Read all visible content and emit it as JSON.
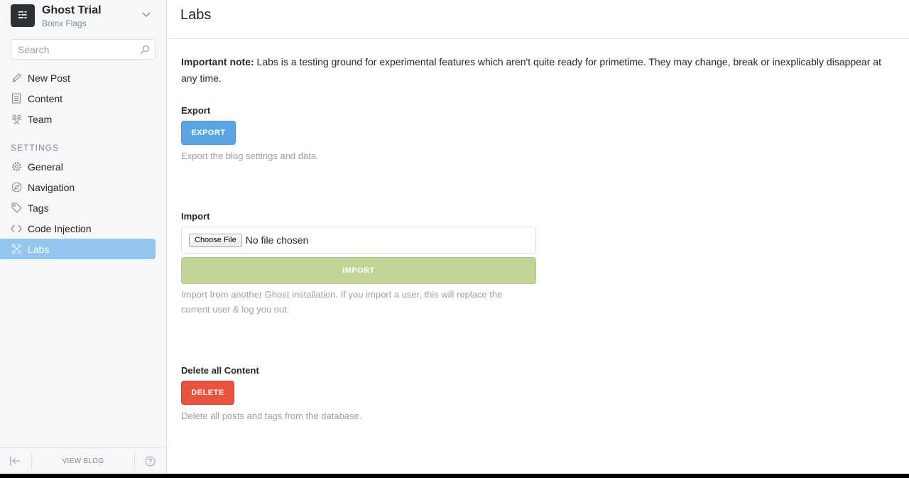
{
  "sidebar": {
    "blog_title": "Ghost Trial",
    "blog_subtitle": "Boinx Flags",
    "search_placeholder": "Search",
    "items": [
      {
        "label": "New Post",
        "icon": "pencil-icon"
      },
      {
        "label": "Content",
        "icon": "content-icon"
      },
      {
        "label": "Team",
        "icon": "team-icon"
      }
    ],
    "settings_label": "SETTINGS",
    "settings_items": [
      {
        "label": "General",
        "icon": "gear-icon"
      },
      {
        "label": "Navigation",
        "icon": "compass-icon"
      },
      {
        "label": "Tags",
        "icon": "tag-icon"
      },
      {
        "label": "Code Injection",
        "icon": "code-icon"
      },
      {
        "label": "Labs",
        "icon": "labs-icon",
        "active": true
      }
    ],
    "footer": {
      "view_blog": "VIEW BLOG"
    }
  },
  "main": {
    "title": "Labs",
    "note_bold": "Important note:",
    "note_text": " Labs is a testing ground for experimental features which aren't quite ready for primetime. They may change, break or inexplicably disappear at any time.",
    "export": {
      "title": "Export",
      "button": "EXPORT",
      "help": "Export the blog settings and data."
    },
    "import": {
      "title": "Import",
      "file_button": "Choose File",
      "file_status": "No file chosen",
      "button": "IMPORT",
      "help_line1": "Import from another Ghost installation. If you import a user, this will replace the",
      "help_line2": "current user & log you out."
    },
    "delete": {
      "title": "Delete all Content",
      "button": "DELETE",
      "help": "Delete all posts and tags from the database."
    }
  },
  "colors": {
    "accent_active": "#94c5ee",
    "export_button": "#5ba4e5",
    "import_button": "#c1d597",
    "delete_button": "#e9533f"
  }
}
